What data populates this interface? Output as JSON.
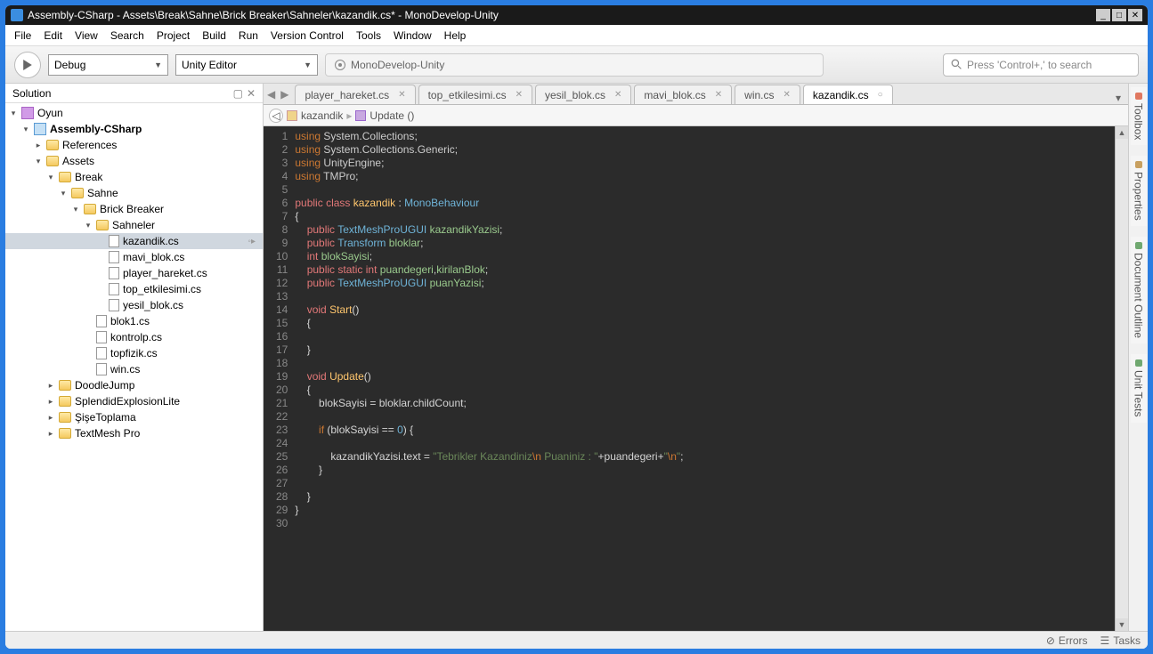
{
  "title": "Assembly-CSharp - Assets\\Break\\Sahne\\Brick Breaker\\Sahneler\\kazandik.cs* - MonoDevelop-Unity",
  "menu": {
    "file": "File",
    "edit": "Edit",
    "view": "View",
    "search": "Search",
    "project": "Project",
    "build": "Build",
    "run": "Run",
    "vcs": "Version Control",
    "tools": "Tools",
    "window": "Window",
    "help": "Help"
  },
  "toolbar": {
    "config": "Debug",
    "target": "Unity Editor",
    "app_target": "MonoDevelop-Unity",
    "search_placeholder": "Press 'Control+,' to search"
  },
  "solution": {
    "header": "Solution",
    "root": "Oyun",
    "project": "Assembly-CSharp",
    "references": "References",
    "assets": "Assets",
    "break": "Break",
    "sahne": "Sahne",
    "brick": "Brick Breaker",
    "sahneler": "Sahneler",
    "files": {
      "kazandik": "kazandik.cs",
      "mavi_blok": "mavi_blok.cs",
      "player_hareket": "player_hareket.cs",
      "top_etkilesimi": "top_etkilesimi.cs",
      "yesil_blok": "yesil_blok.cs",
      "blok1": "blok1.cs",
      "kontrolp": "kontrolp.cs",
      "topfizik": "topfizik.cs",
      "win": "win.cs"
    },
    "doodle": "DoodleJump",
    "splendid": "SplendidExplosionLite",
    "sise": "ŞişeToplama",
    "textmesh": "TextMesh Pro"
  },
  "tabs": {
    "t1": "player_hareket.cs",
    "t2": "top_etkilesimi.cs",
    "t3": "yesil_blok.cs",
    "t4": "mavi_blok.cs",
    "t5": "win.cs",
    "t6": "kazandik.cs"
  },
  "breadcrumb": {
    "class": "kazandik",
    "method": "Update ()"
  },
  "code_lines": 30,
  "status": {
    "errors": "Errors",
    "tasks": "Tasks"
  },
  "side_tabs": {
    "toolbox": "Toolbox",
    "properties": "Properties",
    "doc_outline": "Document Outline",
    "unit_tests": "Unit Tests"
  }
}
